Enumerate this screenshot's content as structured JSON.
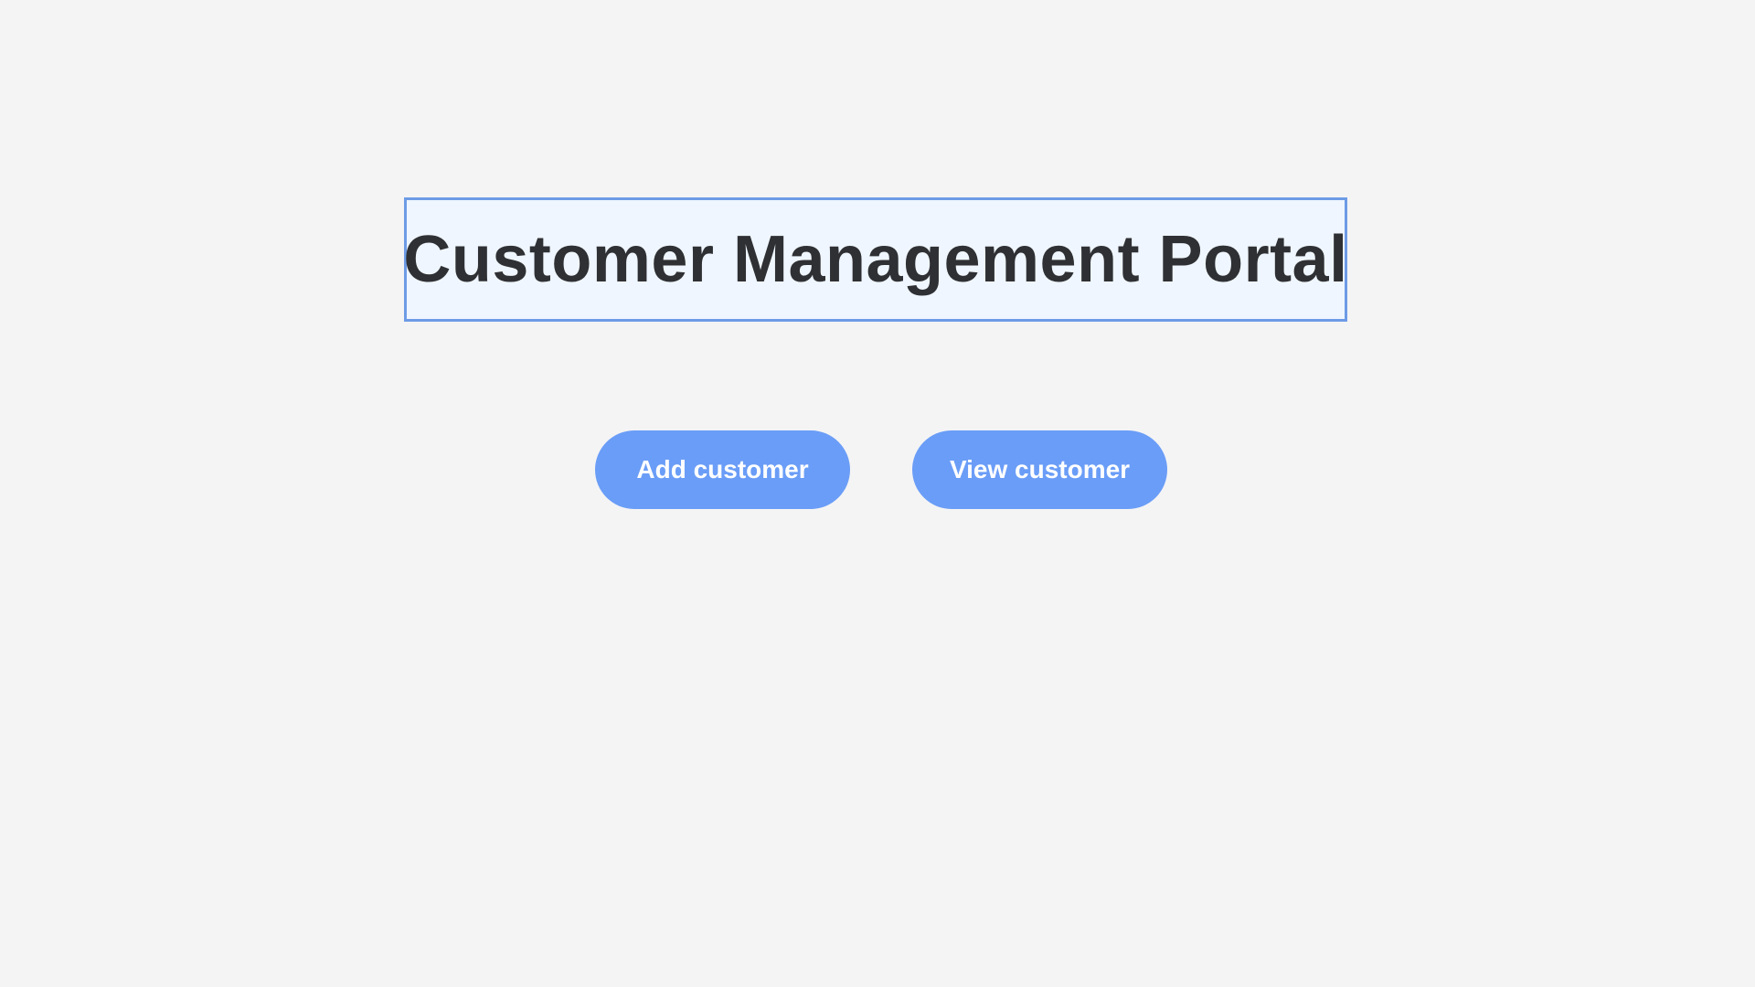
{
  "header": {
    "title": "Customer Management Portal"
  },
  "actions": {
    "add_label": "Add customer",
    "view_label": "View customer"
  },
  "colors": {
    "background": "#f4f4f5",
    "title_border": "#6d9be6",
    "title_background": "#eff6ff",
    "button": "#6a9df7",
    "title_text": "#2f3033"
  }
}
